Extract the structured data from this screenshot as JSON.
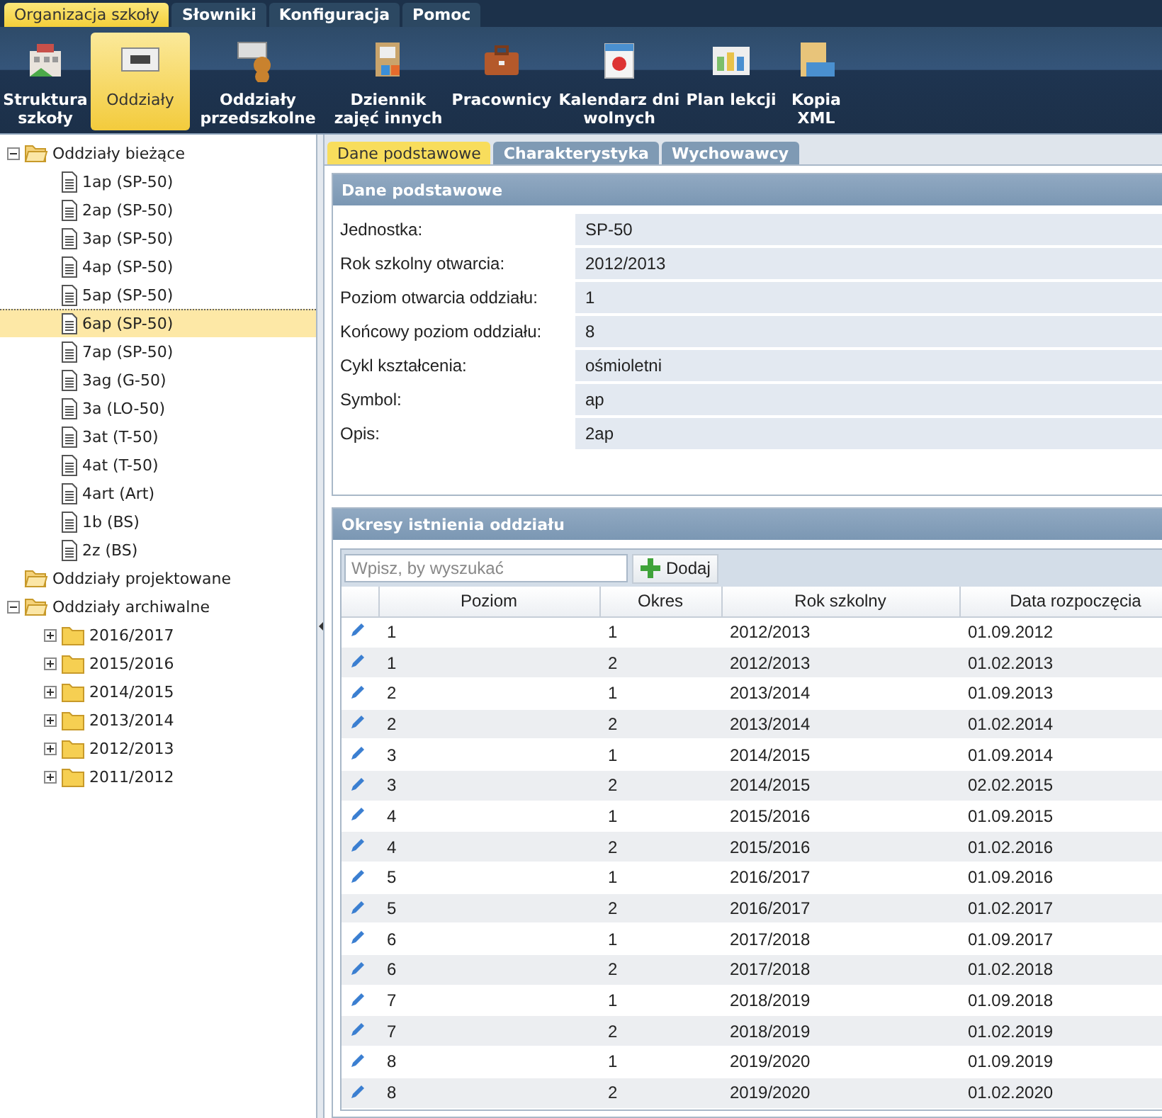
{
  "menu_tabs": [
    {
      "label": "Organizacja szkoły",
      "selected": true
    },
    {
      "label": "Słowniki",
      "selected": false
    },
    {
      "label": "Konfiguracja",
      "selected": false
    },
    {
      "label": "Pomoc",
      "selected": false
    }
  ],
  "toolbar": [
    {
      "label": "Struktura szkoły",
      "selected": false
    },
    {
      "label": "Oddziały",
      "selected": true
    },
    {
      "label": "Oddziały przedszkolne",
      "selected": false
    },
    {
      "label": "Dziennik zajęć innych",
      "selected": false
    },
    {
      "label": "Pracownicy",
      "selected": false
    },
    {
      "label": "Kalendarz dni wolnych",
      "selected": false
    },
    {
      "label": "Plan lekcji",
      "selected": false
    },
    {
      "label": "Kopia XML",
      "selected": false
    }
  ],
  "tree": [
    {
      "kind": "folder",
      "label": "Oddziały bieżące",
      "expanded": true,
      "selected": false,
      "children": [
        {
          "kind": "class",
          "label": "1ap (SP-50)",
          "selected": false
        },
        {
          "kind": "class",
          "label": "2ap (SP-50)",
          "selected": false
        },
        {
          "kind": "class",
          "label": "3ap (SP-50)",
          "selected": false
        },
        {
          "kind": "class",
          "label": "4ap (SP-50)",
          "selected": false
        },
        {
          "kind": "class",
          "label": "5ap (SP-50)",
          "selected": false
        },
        {
          "kind": "class",
          "label": "6ap (SP-50)",
          "selected": true
        },
        {
          "kind": "class",
          "label": "7ap (SP-50)",
          "selected": false
        },
        {
          "kind": "class",
          "label": "3ag (G-50)",
          "selected": false
        },
        {
          "kind": "class",
          "label": "3a (LO-50)",
          "selected": false
        },
        {
          "kind": "class",
          "label": "3at (T-50)",
          "selected": false
        },
        {
          "kind": "class",
          "label": "4at (T-50)",
          "selected": false
        },
        {
          "kind": "class",
          "label": "4art (Art)",
          "selected": false
        },
        {
          "kind": "class",
          "label": "1b (BS)",
          "selected": false
        },
        {
          "kind": "class",
          "label": "2z (BS)",
          "selected": false
        }
      ]
    },
    {
      "kind": "folder",
      "label": "Oddziały projektowane",
      "selected": false
    },
    {
      "kind": "folder",
      "label": "Oddziały archiwalne",
      "expanded": true,
      "selected": false,
      "children": [
        {
          "kind": "year",
          "label": "2016/2017",
          "expanded": false,
          "selected": false
        },
        {
          "kind": "year",
          "label": "2015/2016",
          "expanded": false,
          "selected": false
        },
        {
          "kind": "year",
          "label": "2014/2015",
          "expanded": false,
          "selected": false
        },
        {
          "kind": "year",
          "label": "2013/2014",
          "expanded": false,
          "selected": false
        },
        {
          "kind": "year",
          "label": "2012/2013",
          "expanded": false,
          "selected": false
        },
        {
          "kind": "year",
          "label": "2011/2012",
          "expanded": false,
          "selected": false
        }
      ]
    }
  ],
  "detail_tabs": [
    {
      "label": "Dane podstawowe",
      "selected": true
    },
    {
      "label": "Charakterystyka",
      "selected": false
    },
    {
      "label": "Wychowawcy",
      "selected": false
    }
  ],
  "basic_data": {
    "title": "Dane podstawowe",
    "fields": [
      {
        "label": "Jednostka:",
        "value": "SP-50"
      },
      {
        "label": "Rok szkolny otwarcia:",
        "value": "2012/2013"
      },
      {
        "label": "Poziom otwarcia oddziału:",
        "value": "1"
      },
      {
        "label": "Końcowy poziom oddziału:",
        "value": "8"
      },
      {
        "label": "Cykl kształcenia:",
        "value": "ośmioletni"
      },
      {
        "label": "Symbol:",
        "value": "ap"
      },
      {
        "label": "Opis:",
        "value": "2ap"
      }
    ]
  },
  "periods": {
    "title": "Okresy istnienia oddziału",
    "search": {
      "placeholder": "Wpisz, by wyszukać"
    },
    "add_button": "Dodaj",
    "columns": [
      "Poziom",
      "Okres",
      "Rok szkolny",
      "Data rozpoczęcia"
    ],
    "rows": [
      [
        "1",
        "1",
        "2012/2013",
        "01.09.2012"
      ],
      [
        "1",
        "2",
        "2012/2013",
        "01.02.2013"
      ],
      [
        "2",
        "1",
        "2013/2014",
        "01.09.2013"
      ],
      [
        "2",
        "2",
        "2013/2014",
        "01.02.2014"
      ],
      [
        "3",
        "1",
        "2014/2015",
        "01.09.2014"
      ],
      [
        "3",
        "2",
        "2014/2015",
        "02.02.2015"
      ],
      [
        "4",
        "1",
        "2015/2016",
        "01.09.2015"
      ],
      [
        "4",
        "2",
        "2015/2016",
        "01.02.2016"
      ],
      [
        "5",
        "1",
        "2016/2017",
        "01.09.2016"
      ],
      [
        "5",
        "2",
        "2016/2017",
        "01.02.2017"
      ],
      [
        "6",
        "1",
        "2017/2018",
        "01.09.2017"
      ],
      [
        "6",
        "2",
        "2017/2018",
        "01.02.2018"
      ],
      [
        "7",
        "1",
        "2018/2019",
        "01.09.2018"
      ],
      [
        "7",
        "2",
        "2018/2019",
        "01.02.2019"
      ],
      [
        "8",
        "1",
        "2019/2020",
        "01.09.2019"
      ],
      [
        "8",
        "2",
        "2019/2020",
        "01.02.2020"
      ]
    ]
  }
}
